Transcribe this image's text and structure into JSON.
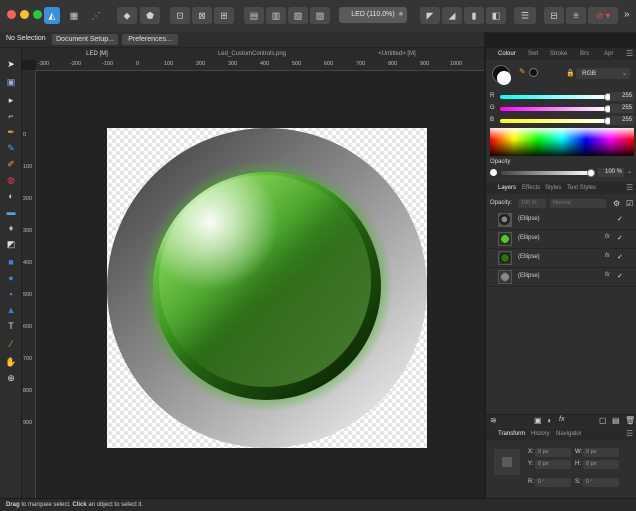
{
  "toolbar": {
    "doc_title": "LED (110.0%)",
    "star": "★",
    "more": "»"
  },
  "context_bar": {
    "selection": "No Selection",
    "document_setup": "Document Setup...",
    "preferences": "Preferences..."
  },
  "doc_tabs": [
    {
      "label": "LED [M]"
    },
    {
      "label": "Led_CustomControls.png"
    },
    {
      "label": "<Untitled> [M]"
    }
  ],
  "ruler_h": [
    "-300",
    "-200",
    "-100",
    "0",
    "100",
    "200",
    "300",
    "400",
    "500",
    "600",
    "700",
    "800",
    "900",
    "1000"
  ],
  "ruler_v": [
    "0",
    "100",
    "200",
    "300",
    "400",
    "500",
    "600",
    "700",
    "800",
    "900"
  ],
  "colour_panel": {
    "tabs": [
      "Colour",
      "Swt",
      "Stroke",
      "Brs",
      "Apr"
    ],
    "model": "RGB",
    "channels": [
      {
        "label": "R",
        "value": "255"
      },
      {
        "label": "G",
        "value": "255"
      },
      {
        "label": "B",
        "value": "255"
      }
    ],
    "opacity_label": "Opacity",
    "opacity_value": "100 %"
  },
  "layers_panel": {
    "tabs": [
      "Layers",
      "Effects",
      "Styles",
      "Text Styles"
    ],
    "opacity_label": "Opacity:",
    "opacity_value": "100 %",
    "blend_mode": "Normal",
    "layers": [
      {
        "name": "(Ellipse)",
        "fx": "",
        "check": "✓"
      },
      {
        "name": "(Ellipse)",
        "fx": "fx",
        "check": "✓"
      },
      {
        "name": "(Ellipse)",
        "fx": "fx",
        "check": "✓"
      },
      {
        "name": "(Ellipse)",
        "fx": "fx",
        "check": "✓"
      }
    ]
  },
  "transform_panel": {
    "tabs": [
      "Transform",
      "History",
      "Navigator"
    ],
    "fields": [
      {
        "label": "X:",
        "value": "0 px"
      },
      {
        "label": "W:",
        "value": "0 px"
      },
      {
        "label": "Y:",
        "value": "0 px"
      },
      {
        "label": "H:",
        "value": "0 px"
      },
      {
        "label": "R:",
        "value": "0 °"
      },
      {
        "label": "S:",
        "value": "0 °"
      }
    ]
  },
  "status": {
    "drag": "Drag",
    "text1": " to marquee select. ",
    "click": "Click",
    "text2": " an object to select it."
  },
  "colors": {
    "accent": "#3b8fd8",
    "led_green": "#3fa02a"
  }
}
